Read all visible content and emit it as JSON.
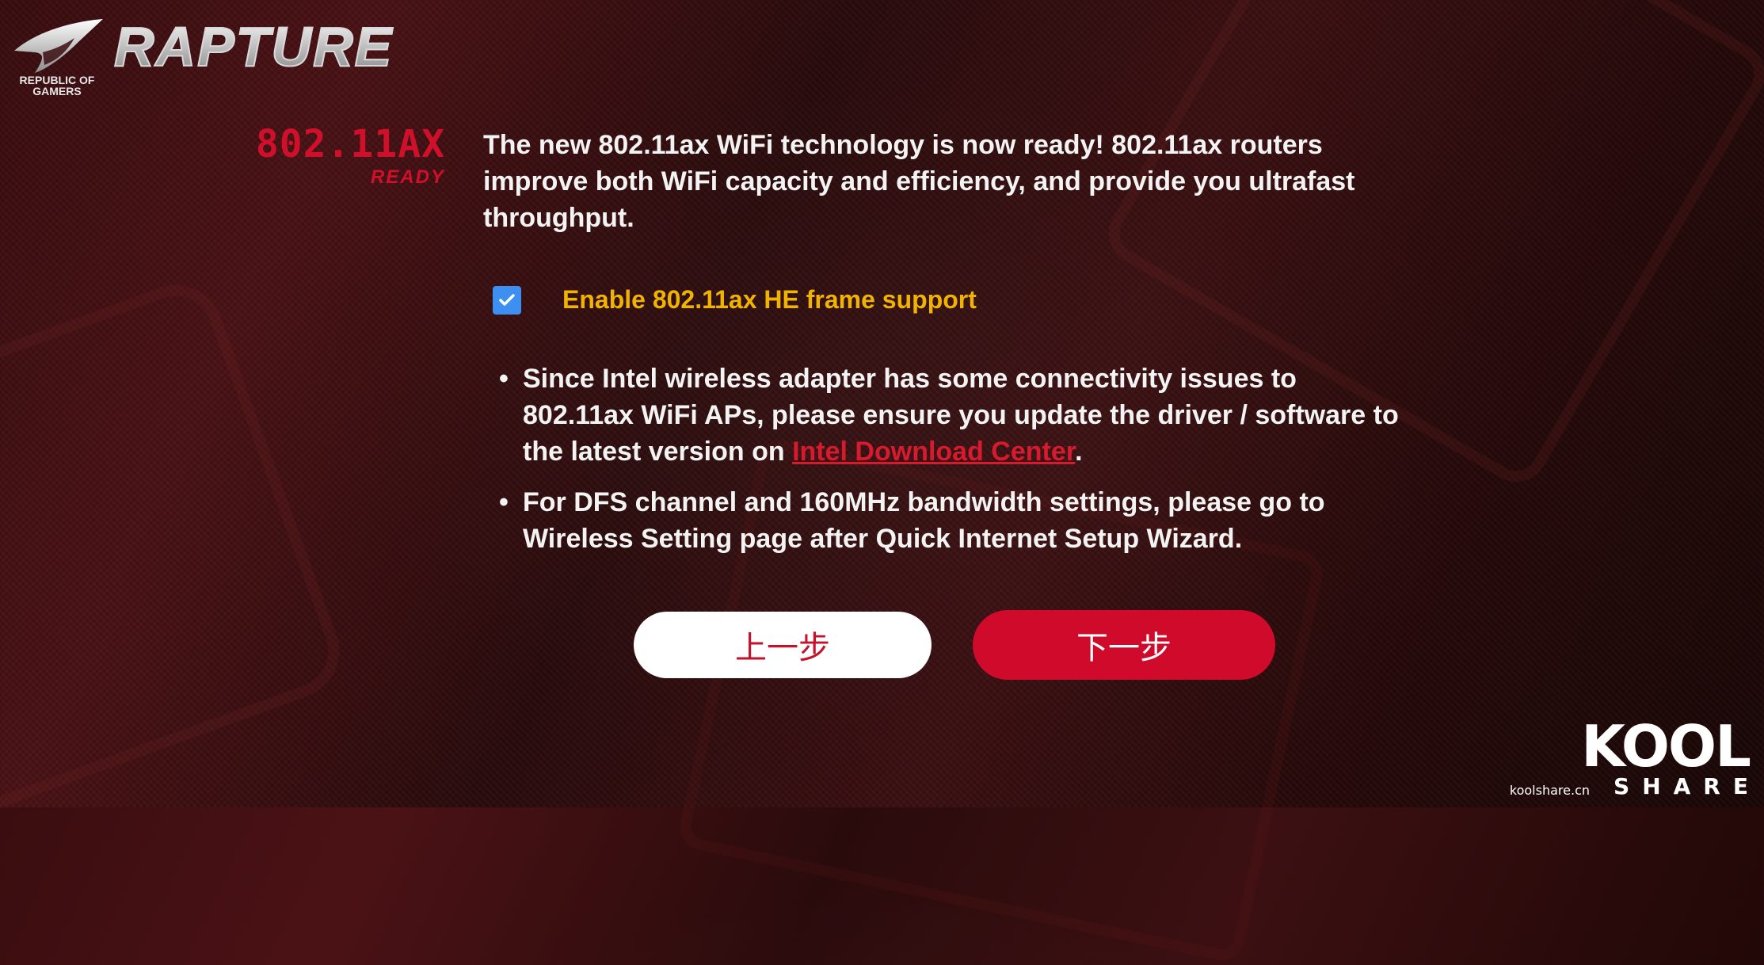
{
  "logo": {
    "title": "RAPTURE",
    "subtitle_line1": "REPUBLIC OF",
    "subtitle_line2": "GAMERS"
  },
  "badge": {
    "title": "802.11AX",
    "subtitle": "READY"
  },
  "intro_text": "The new 802.11ax WiFi technology is now ready! 802.11ax routers improve both WiFi capacity and efficiency, and provide you ultrafast throughput.",
  "checkbox": {
    "label": "Enable 802.11ax HE frame support",
    "checked": true,
    "color": "#3d8ff2"
  },
  "notes": {
    "item1_prefix": "Since Intel wireless adapter has some connectivity issues to 802.11ax WiFi APs, please ensure you update the driver / software to the latest version on ",
    "item1_link": "Intel Download Center",
    "item1_suffix": ".",
    "item2": "For DFS channel and 160MHz bandwidth settings, please go to Wireless Setting page after Quick Internet Setup Wizard."
  },
  "buttons": {
    "prev_label": "上一步",
    "next_label": "下一步"
  },
  "watermark": {
    "site": "koolshare.cn",
    "brand": "KOOL",
    "tag": "SHARE"
  },
  "colors": {
    "accent_red": "#cf0a2b",
    "label_yellow": "#f0b300",
    "link_red": "#d81a2e"
  }
}
